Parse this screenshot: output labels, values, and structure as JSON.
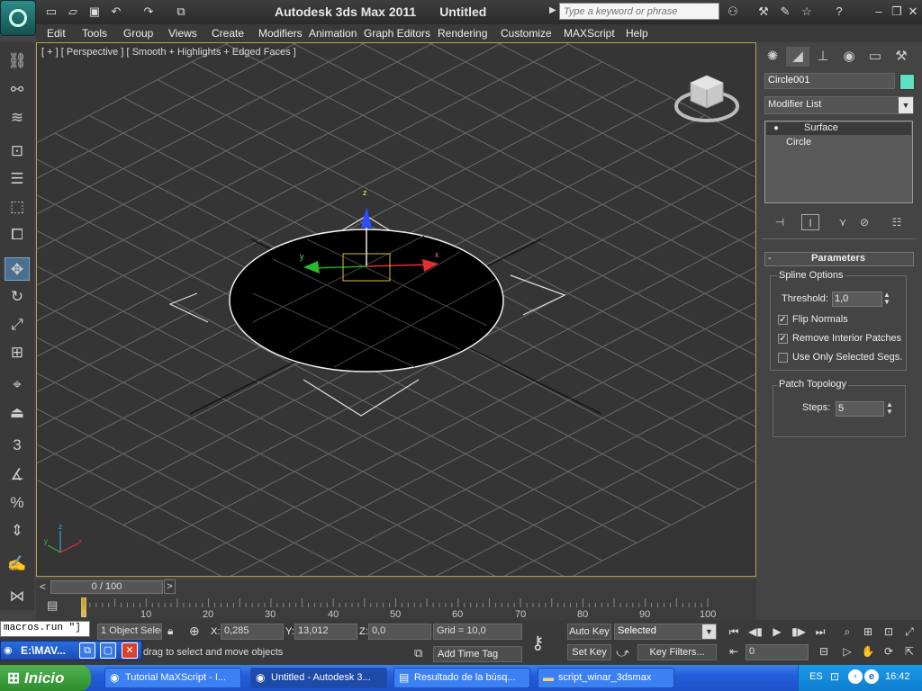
{
  "titlebar": {
    "app": "Autodesk 3ds Max  2011",
    "document": "Untitled",
    "search_placeholder": "Type a keyword or phrase"
  },
  "menu": [
    "Edit",
    "Tools",
    "Group",
    "Views",
    "Create",
    "Modifiers",
    "Animation",
    "Graph Editors",
    "Rendering",
    "Customize",
    "MAXScript",
    "Help"
  ],
  "viewport": {
    "label": "[ + ] [ Perspective ] [ Smooth + Highlights + Edged Faces ]",
    "axis_labels": {
      "x": "x",
      "y": "y",
      "z": "z"
    }
  },
  "command_panel": {
    "object_name": "Circle001",
    "object_color": "#5fe0c2",
    "modifier_list": "Modifier List",
    "stack": [
      "Surface",
      "Circle"
    ],
    "rollout_toggle": "-",
    "rollout_title": "Parameters",
    "spline_options": {
      "title": "Spline Options",
      "threshold_label": "Threshold:",
      "threshold_value": "1,0",
      "flip_normals": {
        "label": "Flip Normals",
        "checked": true
      },
      "remove_interior": {
        "label": "Remove Interior Patches",
        "checked": true
      },
      "use_only_selected": {
        "label": "Use Only Selected Segs.",
        "checked": false
      }
    },
    "patch_topology": {
      "title": "Patch Topology",
      "steps_label": "Steps:",
      "steps_value": "5"
    }
  },
  "timeline": {
    "slider": "0 / 100",
    "prev": "<",
    "next": ">",
    "ticks": [
      "0",
      "10",
      "20",
      "30",
      "40",
      "50",
      "60",
      "70",
      "80",
      "90",
      "100"
    ]
  },
  "status": {
    "listener": "macros.run \"]",
    "selection": "1 Object Selec",
    "prompt": "drag to select and move objects",
    "x_label": "X:",
    "x_value": "0,285",
    "y_label": "Y:",
    "y_value": "13,012",
    "z_label": "Z:",
    "z_value": "0,0",
    "grid": "Grid = 10,0",
    "add_time_tag": "Add Time Tag",
    "auto_key": "Auto Key",
    "set_key": "Set Key",
    "key_mode": "Selected",
    "key_filters": "Key Filters...",
    "frame": "0"
  },
  "max_window": "E:\\MAV...",
  "taskbar": {
    "start": "Inicio",
    "tasks": [
      "Tutorial MaXScript - I...",
      "Untitled - Autodesk 3...",
      "Resultado de la búsq...",
      "script_winar_3dsmax"
    ],
    "lang": "ES",
    "clock": "16:42"
  }
}
